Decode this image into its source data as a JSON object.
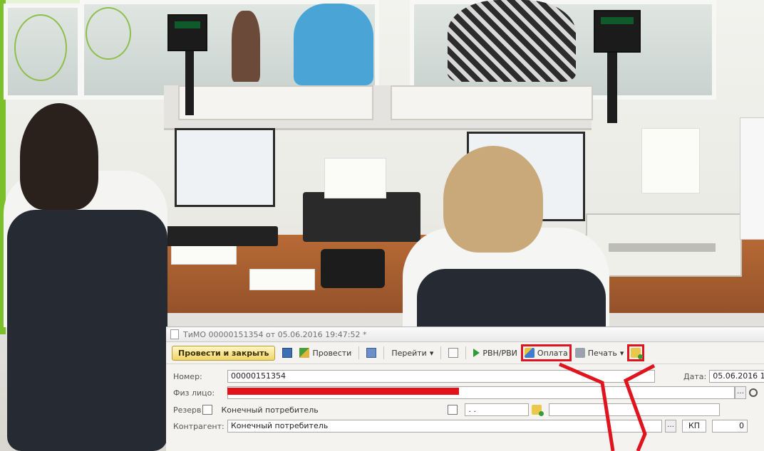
{
  "window": {
    "title": "ТиМО 00000151354 от 05.06.2016 19:47:52 *"
  },
  "toolbar": {
    "post_close_label": "Провести и закрыть",
    "post_label": "Провести",
    "goto_label": "Перейти",
    "rvn_label": "РВН/РВИ",
    "payment_label": "Оплата",
    "print_label": "Печать"
  },
  "form": {
    "number_label": "Номер:",
    "number_value": "00000151354",
    "date_label": "Дата:",
    "date_value": "05.06.2016 19:47:5",
    "phys_label": "Физ лицо:",
    "reserve_label": "Резерв",
    "reserve_value": "Конечный потребитель",
    "reserve_date_value": " . . ",
    "contractor_label": "Контрагент:",
    "contractor_value": "Конечный потребитель",
    "kp_label": "КП",
    "count_value": "0"
  },
  "colors": {
    "highlight": "#e0141e",
    "primary_button": "#f0d56a"
  }
}
